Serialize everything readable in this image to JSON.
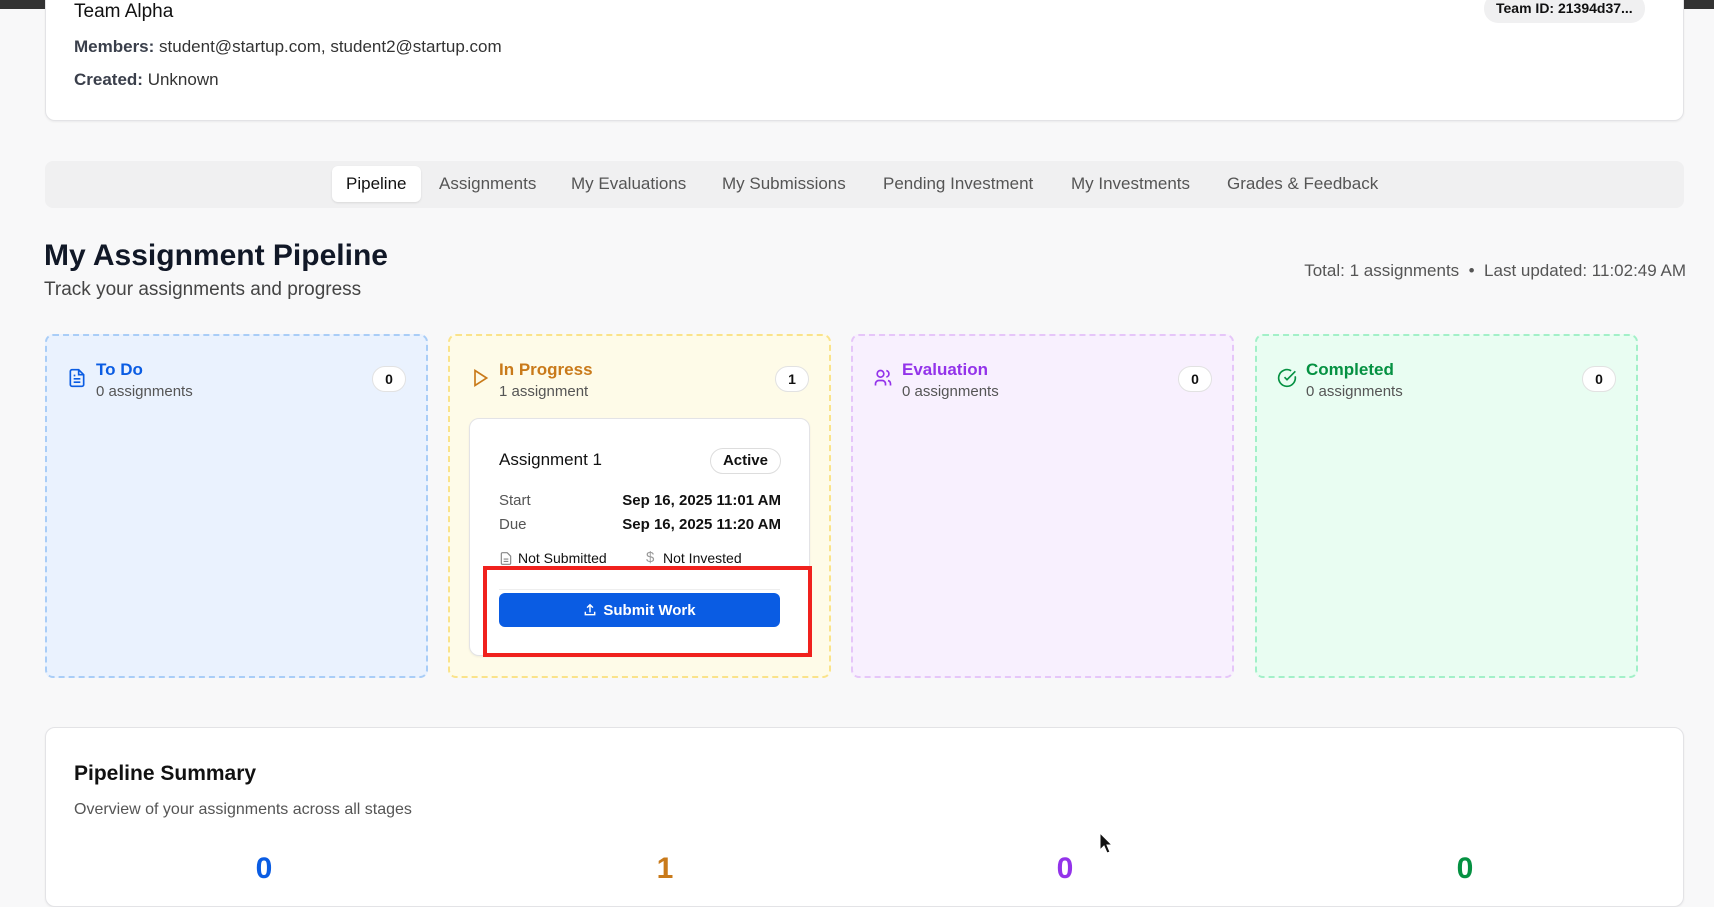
{
  "team": {
    "name": "Team Alpha",
    "id_label": "Team ID: 21394d37...",
    "members_label": "Members:",
    "members": "student@startup.com, student2@startup.com",
    "created_label": "Created:",
    "created": "Unknown"
  },
  "tabs": [
    {
      "label": "Pipeline",
      "active": true
    },
    {
      "label": "Assignments"
    },
    {
      "label": "My Evaluations"
    },
    {
      "label": "My Submissions"
    },
    {
      "label": "Pending Investment"
    },
    {
      "label": "My Investments"
    },
    {
      "label": "Grades & Feedback"
    }
  ],
  "pipeline": {
    "title": "My Assignment Pipeline",
    "subtitle": "Track your assignments and progress",
    "total": "Total: 1 assignments",
    "updated": "Last updated: 11:02:49 AM",
    "columns": [
      {
        "title": "To Do",
        "count_text": "0 assignments",
        "badge": "0",
        "icon": "file-text-icon",
        "color": "#0a5ce3"
      },
      {
        "title": "In Progress",
        "count_text": "1 assignment",
        "badge": "1",
        "icon": "play-icon",
        "color": "#c97a1a"
      },
      {
        "title": "Evaluation",
        "count_text": "0 assignments",
        "badge": "0",
        "icon": "users-icon",
        "color": "#9333ea"
      },
      {
        "title": "Completed",
        "count_text": "0 assignments",
        "badge": "0",
        "icon": "check-circle-icon",
        "color": "#059142"
      }
    ],
    "assignment": {
      "title": "Assignment 1",
      "status": "Active",
      "start_label": "Start",
      "start": "Sep 16, 2025 11:01 AM",
      "due_label": "Due",
      "due": "Sep 16, 2025 11:20 AM",
      "submission": "Not Submitted",
      "investment": "Not Invested",
      "action": "Submit Work"
    }
  },
  "summary": {
    "title": "Pipeline Summary",
    "subtitle": "Overview of your assignments across all stages",
    "values": [
      "0",
      "1",
      "0",
      "0"
    ]
  }
}
